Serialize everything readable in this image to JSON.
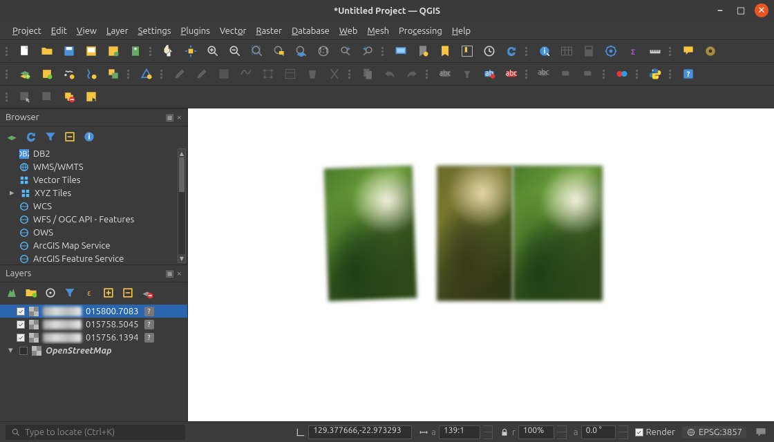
{
  "window": {
    "title": "*Untitled Project — QGIS"
  },
  "menu": [
    "Project",
    "Edit",
    "View",
    "Layer",
    "Settings",
    "Plugins",
    "Vector",
    "Raster",
    "Database",
    "Web",
    "Mesh",
    "Processing",
    "Help"
  ],
  "browser": {
    "title": "Browser",
    "items": [
      {
        "icon": "db2",
        "label": "DB2"
      },
      {
        "icon": "globe",
        "label": "WMS/WMTS"
      },
      {
        "icon": "grid",
        "label": "Vector Tiles"
      },
      {
        "icon": "grid",
        "label": "XYZ Tiles",
        "expand": true
      },
      {
        "icon": "globe",
        "label": "WCS"
      },
      {
        "icon": "globe",
        "label": "WFS / OGC API - Features"
      },
      {
        "icon": "globe",
        "label": "OWS"
      },
      {
        "icon": "globe",
        "label": "ArcGIS Map Service"
      },
      {
        "icon": "globe",
        "label": "ArcGIS Feature Service"
      }
    ]
  },
  "layers": {
    "title": "Layers",
    "rows": [
      {
        "checked": true,
        "suffix": "015800.7083",
        "sel": true
      },
      {
        "checked": true,
        "suffix": "015758.5045",
        "sel": false
      },
      {
        "checked": true,
        "suffix": "015756.1394",
        "sel": false
      }
    ],
    "osm": "OpenStreetMap"
  },
  "status": {
    "locator_placeholder": "Type to locate (Ctrl+K)",
    "coord": "129.377666,-22.973293",
    "scale": "139:1",
    "magnifier": "100%",
    "rotation": "0.0 °",
    "render": "Render",
    "crs": "EPSG:3857"
  }
}
